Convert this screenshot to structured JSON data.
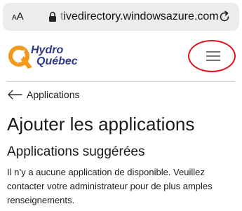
{
  "browser": {
    "text_size_label_small": "A",
    "text_size_label_big": "A",
    "url_prefix": "t",
    "url": "ivedirectory.windowsazure.com",
    "lock_icon": "lock-icon",
    "reload_icon": "reload-icon"
  },
  "header": {
    "logo_line1": "Hydro",
    "logo_line2": "Québec",
    "logo_colors": {
      "q_orange": "#f39a1e",
      "text_blue": "#2d3a8c"
    },
    "menu_icon": "hamburger-menu-icon",
    "highlight_color": "#e0121b"
  },
  "nav": {
    "back_label": "Applications",
    "back_icon": "arrow-left-icon"
  },
  "main": {
    "title": "Ajouter les applications",
    "section_title": "Applications suggérées",
    "message": "Il n’y a aucune application de disponible. Veuillez contacter votre administrateur pour de plus amples renseignements."
  }
}
